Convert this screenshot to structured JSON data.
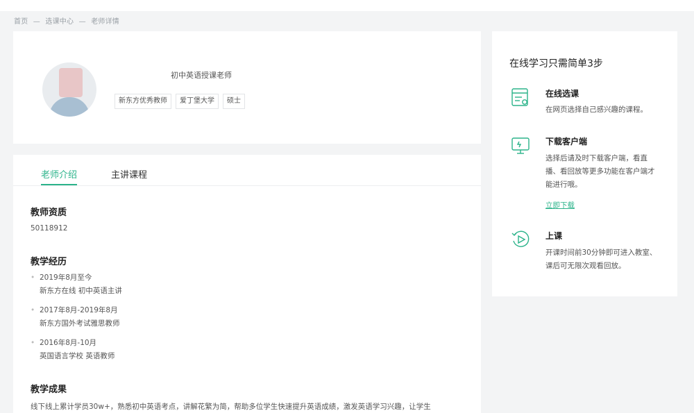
{
  "breadcrumb": [
    "首页",
    "选课中心",
    "老师详情"
  ],
  "breadcrumb_sep": "—",
  "profile": {
    "title": "初中英语授课老师",
    "tags": [
      "新东方优秀教师",
      "爱丁堡大学",
      "硕士"
    ]
  },
  "tabs": [
    {
      "label": "老师介绍",
      "active": true
    },
    {
      "label": "主讲课程",
      "active": false
    }
  ],
  "sections": {
    "qualification_title": "教师资质",
    "qualification_value": "50118912",
    "experience_title": "教学经历",
    "experience": [
      {
        "period": "2019年8月至今",
        "desc": "新东方在线 初中英语主讲"
      },
      {
        "period": "2017年8月-2019年8月",
        "desc": "新东方国外考试雅思教师"
      },
      {
        "period": "2016年8月-10月",
        "desc": "英国语言学校 英语教师"
      }
    ],
    "achievement_title": "教学成果",
    "achievement_text": "线下线上累计学员30w+，熟悉初中英语考点，讲解花繁为简，帮助多位学生快速提升英语成绩，激发英语学习兴趣，让学生"
  },
  "steps": {
    "title": "在线学习只需简单3步",
    "items": [
      {
        "name": "在线选课",
        "desc": "在网页选择自己感兴趣的课程。",
        "icon": "course-list-icon"
      },
      {
        "name": "下载客户端",
        "desc": "选择后请及时下载客户端，看直播、看回放等更多功能在客户端才能进行哦。",
        "icon": "monitor-icon"
      },
      {
        "name": "上课",
        "desc": "开课时间前30分钟即可进入教室、课后可无限次观看回放。",
        "icon": "play-icon"
      }
    ],
    "download_link": "立即下载"
  },
  "colors": {
    "accent": "#2bb38a",
    "background": "#f3f4f5"
  }
}
